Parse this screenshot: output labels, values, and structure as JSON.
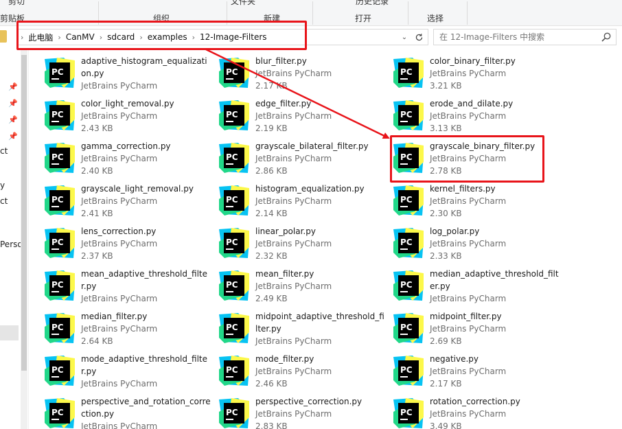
{
  "ribbon": {
    "top_left_text": "剪切",
    "paste_shortcut_text": "剪贴板",
    "groups": [
      "组织",
      "新建",
      "打开",
      "选择"
    ],
    "top_labels": [
      "文件夹",
      "历史记录"
    ]
  },
  "address_bar": {
    "crumbs": [
      "此电脑",
      "CanMV",
      "sdcard",
      "examples",
      "12-Image-Filters"
    ]
  },
  "search": {
    "placeholder": "在 12-Image-Filters 中搜索"
  },
  "nav_pane": {
    "items": [
      "ct",
      "y",
      "ct",
      "Perso"
    ]
  },
  "file_type": "JetBrains PyCharm",
  "files": [
    {
      "name": "adaptive_histogram_equalization.py",
      "type": "JetBrains PyCharm",
      "size": ""
    },
    {
      "name": "blur_filter.py",
      "type": "JetBrains PyCharm",
      "size": "2.17 KB"
    },
    {
      "name": "color_binary_filter.py",
      "type": "JetBrains PyCharm",
      "size": "3.21 KB"
    },
    {
      "name": "color_light_removal.py",
      "type": "JetBrains PyCharm",
      "size": "2.43 KB"
    },
    {
      "name": "edge_filter.py",
      "type": "JetBrains PyCharm",
      "size": "2.19 KB"
    },
    {
      "name": "erode_and_dilate.py",
      "type": "JetBrains PyCharm",
      "size": "3.13 KB"
    },
    {
      "name": "gamma_correction.py",
      "type": "JetBrains PyCharm",
      "size": "2.40 KB"
    },
    {
      "name": "grayscale_bilateral_filter.py",
      "type": "JetBrains PyCharm",
      "size": "2.86 KB"
    },
    {
      "name": "grayscale_binary_filter.py",
      "type": "JetBrains PyCharm",
      "size": "2.78 KB"
    },
    {
      "name": "grayscale_light_removal.py",
      "type": "JetBrains PyCharm",
      "size": "2.41 KB"
    },
    {
      "name": "histogram_equalization.py",
      "type": "JetBrains PyCharm",
      "size": "2.14 KB"
    },
    {
      "name": "kernel_filters.py",
      "type": "JetBrains PyCharm",
      "size": "2.30 KB"
    },
    {
      "name": "lens_correction.py",
      "type": "JetBrains PyCharm",
      "size": "2.37 KB"
    },
    {
      "name": "linear_polar.py",
      "type": "JetBrains PyCharm",
      "size": "2.32 KB"
    },
    {
      "name": "log_polar.py",
      "type": "JetBrains PyCharm",
      "size": "2.33 KB"
    },
    {
      "name": "mean_adaptive_threshold_filter.py",
      "type": "JetBrains PyCharm",
      "size": ""
    },
    {
      "name": "mean_filter.py",
      "type": "JetBrains PyCharm",
      "size": "2.49 KB"
    },
    {
      "name": "median_adaptive_threshold_filter.py",
      "type": "JetBrains PyCharm",
      "size": ""
    },
    {
      "name": "median_filter.py",
      "type": "JetBrains PyCharm",
      "size": "2.64 KB"
    },
    {
      "name": "midpoint_adaptive_threshold_filter.py",
      "type": "JetBrains PyCharm",
      "size": ""
    },
    {
      "name": "midpoint_filter.py",
      "type": "JetBrains PyCharm",
      "size": "2.69 KB"
    },
    {
      "name": "mode_adaptive_threshold_filter.py",
      "type": "JetBrains PyCharm",
      "size": ""
    },
    {
      "name": "mode_filter.py",
      "type": "JetBrains PyCharm",
      "size": "2.46 KB"
    },
    {
      "name": "negative.py",
      "type": "JetBrains PyCharm",
      "size": "2.17 KB"
    },
    {
      "name": "perspective_and_rotation_correction.py",
      "type": "JetBrains PyCharm",
      "size": ""
    },
    {
      "name": "perspective_correction.py",
      "type": "JetBrains PyCharm",
      "size": "2.83 KB"
    },
    {
      "name": "rotation_correction.py",
      "type": "JetBrains PyCharm",
      "size": "3.49 KB"
    }
  ],
  "annotation": {
    "color": "#e8141a",
    "highlighted_file": "grayscale_binary_filter.py"
  },
  "colors": {
    "pycharm_green": "#21d789",
    "pycharm_yellow": "#fcf84a",
    "pycharm_blue": "#07c3f2",
    "pycharm_dark": "#000000"
  }
}
